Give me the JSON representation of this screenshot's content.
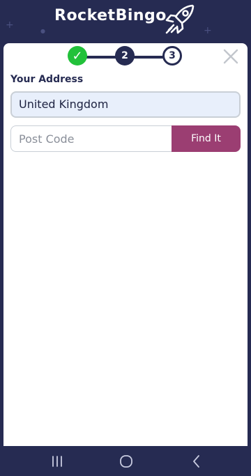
{
  "app": {
    "brand": "RocketBingo"
  },
  "stepper": {
    "steps": [
      {
        "label": "✓",
        "state": "complete"
      },
      {
        "label": "2",
        "state": "current"
      },
      {
        "label": "3",
        "state": "upcoming"
      }
    ]
  },
  "form": {
    "section_title": "Your Address",
    "country_value": "United Kingdom",
    "postcode_placeholder": "Post Code",
    "find_button_label": "Find It"
  },
  "colors": {
    "background": "#262b52",
    "accent_button": "#9b3e72",
    "step_complete": "#22c13a",
    "field_fill": "#e8effb"
  },
  "icons": {
    "logo": "rocket-icon",
    "close": "close-icon",
    "nav_recent": "recent-apps-icon",
    "nav_home": "home-icon",
    "nav_back": "back-icon"
  }
}
